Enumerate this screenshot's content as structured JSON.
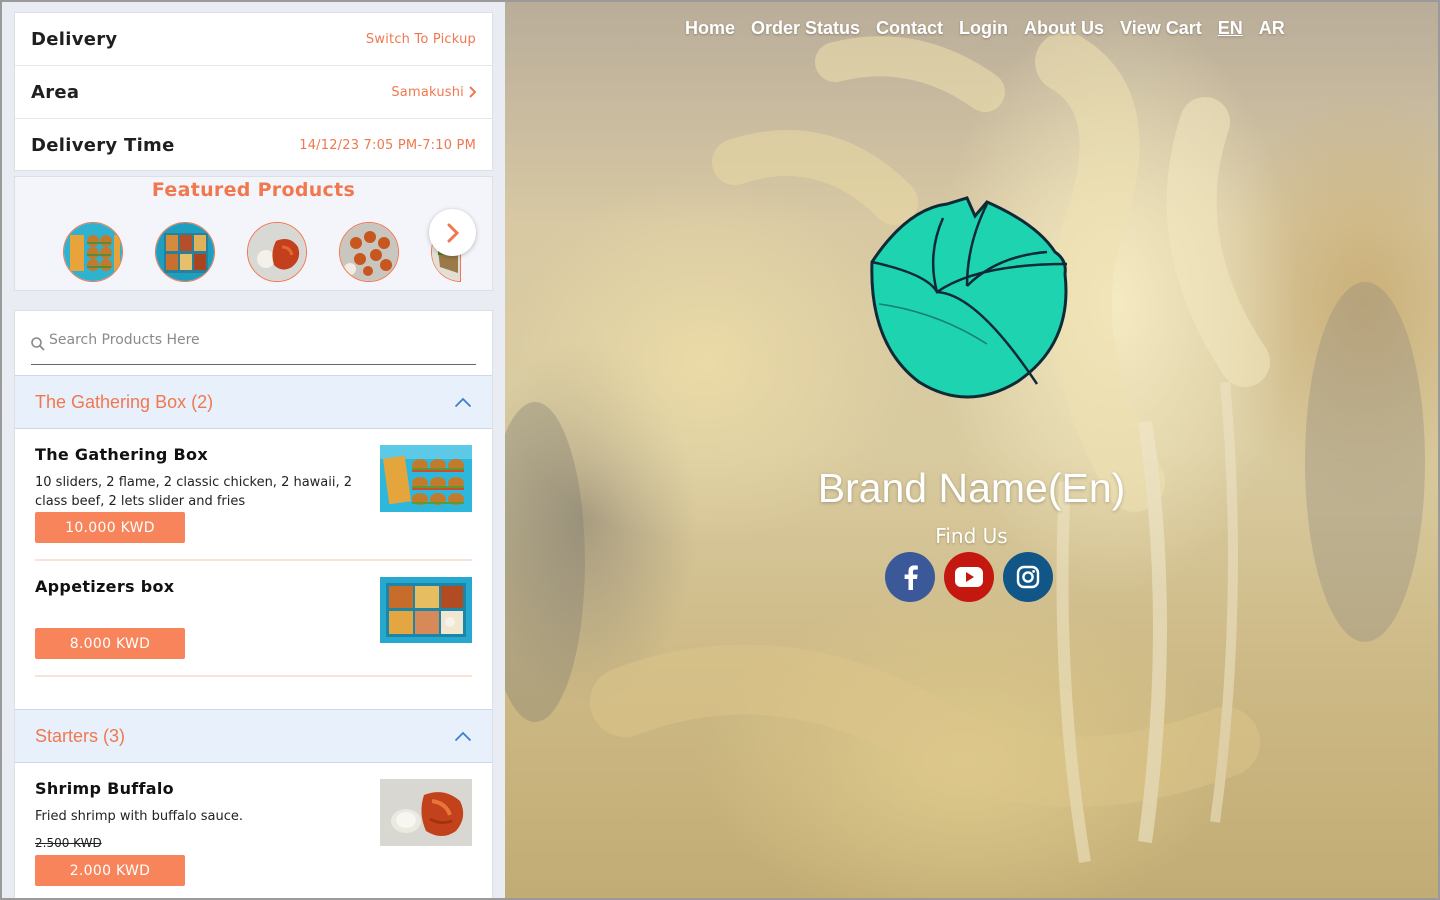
{
  "order_info": {
    "mode_label": "Delivery",
    "switch_label": "Switch To Pickup",
    "area_label": "Area",
    "area_value": "Samakushi",
    "time_label": "Delivery Time",
    "time_value": "14/12/23 7:05 PM-7:10 PM"
  },
  "featured": {
    "title": "Featured Products",
    "thumbnails": [
      "burger-box-thumb",
      "appetizers-box-thumb",
      "shrimp-buffalo-thumb",
      "wings-thumb",
      "wrap-thumb"
    ]
  },
  "search": {
    "placeholder": "Search Products Here"
  },
  "categories": [
    {
      "title": "The Gathering Box (2)",
      "products": [
        {
          "name": "The Gathering Box",
          "description": "10 sliders, 2 flame, 2 classic chicken, 2 hawaii, 2 class beef, 2 lets slider and fries",
          "price": "10.000 KWD"
        },
        {
          "name": "Appetizers box",
          "description": "",
          "price": "8.000 KWD"
        }
      ]
    },
    {
      "title": "Starters (3)",
      "products": [
        {
          "name": "Shrimp Buffalo",
          "description": "Fried shrimp with buffalo sauce.",
          "old_price": "2.500 KWD",
          "price": "2.000 KWD"
        }
      ]
    }
  ],
  "nav": {
    "items": [
      "Home",
      "Order Status",
      "Contact",
      "Login",
      "About Us",
      "View Cart",
      "EN",
      "AR"
    ],
    "active": "EN"
  },
  "hero": {
    "brand_name": "Brand Name(En)",
    "find_us": "Find Us",
    "socials": [
      "facebook-icon",
      "youtube-icon",
      "instagram-icon"
    ]
  },
  "colors": {
    "accent": "#f0784f",
    "price_button": "#f7845a",
    "category_bg": "#e8f0fb",
    "facebook": "#3b5998",
    "youtube": "#c4170f",
    "instagram": "#125688"
  }
}
